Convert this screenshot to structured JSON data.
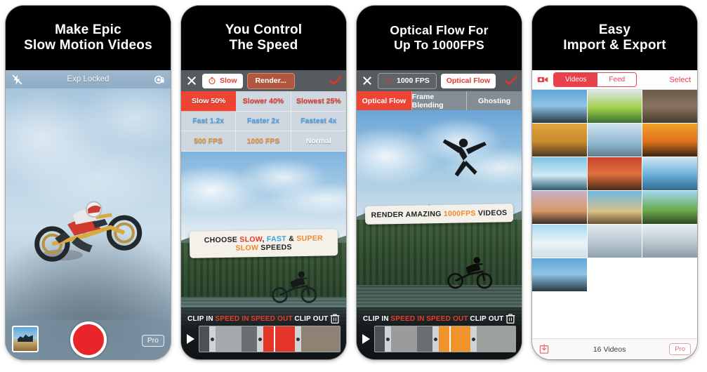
{
  "panels": [
    {
      "id": "panel-capture",
      "headline": {
        "line1": "Make Epic",
        "line2": "Slow Motion Videos"
      },
      "toolbar": {
        "left_icon": "flash-off-icon",
        "status": "Exp Locked",
        "right_icon": "exposure-lock-icon"
      },
      "bottom": {
        "thumbnail": "last-capture-thumbnail",
        "record": "record-button",
        "pro_label": "Pro"
      }
    },
    {
      "id": "panel-speed",
      "headline": {
        "line1": "You Control",
        "line2": "The Speed"
      },
      "toolbar": {
        "close": "close-icon",
        "mode_label": "Slow",
        "mode_icon": "stopwatch-icon",
        "render_label": "Render...",
        "check_icon": "check-icon"
      },
      "speed_grid": [
        {
          "label": "Slow 50%",
          "color": "white",
          "selected": true
        },
        {
          "label": "Slower 40%",
          "color": "red",
          "selected": false
        },
        {
          "label": "Slowest 25%",
          "color": "red",
          "selected": false
        },
        {
          "label": "Fast 1.2x",
          "color": "blue",
          "selected": false
        },
        {
          "label": "Faster 2x",
          "color": "blue",
          "selected": false
        },
        {
          "label": "Fastest 4x",
          "color": "blue",
          "selected": false
        },
        {
          "label": "500 FPS",
          "color": "orange",
          "selected": false
        },
        {
          "label": "1000 FPS",
          "color": "orange",
          "selected": false
        },
        {
          "label": "Normal",
          "color": "white",
          "selected": false
        }
      ],
      "banner": {
        "parts": [
          {
            "text": "CHOOSE ",
            "style": "plain"
          },
          {
            "text": "SLOW",
            "style": "r"
          },
          {
            "text": ", ",
            "style": "plain"
          },
          {
            "text": "FAST",
            "style": "b"
          },
          {
            "text": " & ",
            "style": "plain"
          },
          {
            "text": "SUPER SLOW",
            "style": "o"
          },
          {
            "text": " SPEEDS",
            "style": "plain"
          }
        ]
      },
      "actions": {
        "clip_in": "CLIP IN",
        "speed_in": "SPEED IN",
        "speed_out": "SPEED OUT",
        "clip_out": "CLIP OUT",
        "trash": "trash-icon",
        "play": "play-icon"
      },
      "timeline_accent": "#ea3b2d"
    },
    {
      "id": "panel-optical-flow",
      "headline": {
        "line1": "Optical Flow For",
        "line2": "Up To 1000FPS"
      },
      "toolbar": {
        "close": "close-icon",
        "fps_label": "1000 FPS",
        "fps_icon": "stopwatch-icon",
        "mode_label": "Optical Flow",
        "check_icon": "check-icon"
      },
      "mode_tabs": [
        {
          "label": "Optical Flow",
          "active": true
        },
        {
          "label": "Frame Blending",
          "active": false
        },
        {
          "label": "Ghosting",
          "active": false
        }
      ],
      "banner": {
        "parts": [
          {
            "text": "RENDER AMAZING ",
            "style": "plain"
          },
          {
            "text": "1000FPS",
            "style": "o"
          },
          {
            "text": " VIDEOS",
            "style": "plain"
          }
        ]
      },
      "actions": {
        "clip_in": "CLIP IN",
        "speed_in": "SPEED IN",
        "speed_out": "SPEED OUT",
        "clip_out": "CLIP OUT",
        "trash": "trash-icon",
        "play": "play-icon"
      },
      "timeline_accent": "#f0932b"
    },
    {
      "id": "panel-library",
      "headline": {
        "line1": "Easy",
        "line2": "Import & Export"
      },
      "toolbar": {
        "camera_icon": "video-camera-icon",
        "tabs": [
          {
            "label": "Videos",
            "active": true
          },
          {
            "label": "Feed",
            "active": false
          }
        ],
        "select_label": "Select"
      },
      "grid": {
        "rows": 6,
        "columns": 3,
        "last_row_filled": 1,
        "thumbnails": [
          "motocross-blue-sky",
          "kayak-green",
          "bmx-rock-jump",
          "quad-desert",
          "volleyball-net",
          "kitesurf-sunset",
          "surfer-wave",
          "mtb-red-ramp",
          "paraglider-coast",
          "bmx-dusk-ramp",
          "dirtbike-dunes",
          "wakeboard-green",
          "snowboard-snow",
          "skier-powder",
          "skier-trees"
        ]
      },
      "bottom": {
        "import_icon": "import-icon",
        "count": "16 Videos",
        "pro_label": "Pro"
      }
    }
  ],
  "colors": {
    "accent_red": "#ee4433",
    "accent_orange": "#f0932b",
    "accent_blue": "#4ba3e8",
    "record_red": "#e8252a",
    "toolbar_gray": "#565b60"
  }
}
